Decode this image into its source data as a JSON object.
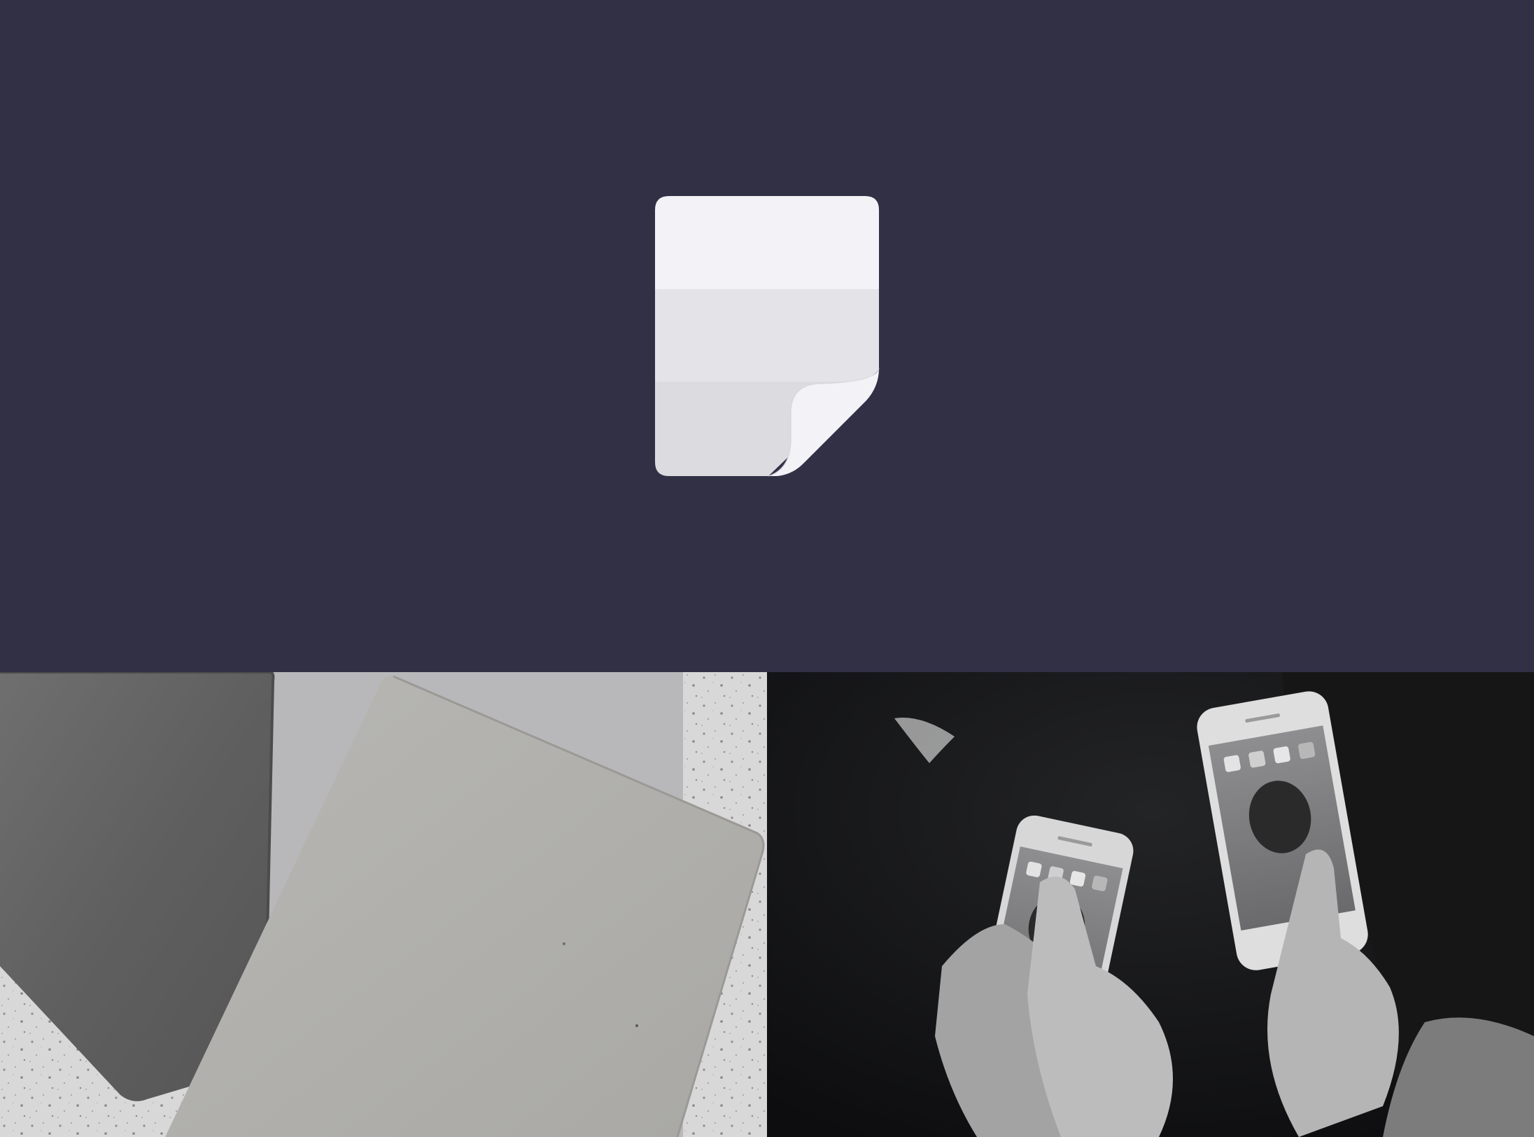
{
  "colors": {
    "hero_background": "#323045",
    "logo_top": "#f3f2f7",
    "logo_middle": "#e4e3e8",
    "logo_bottom": "#dcdbe0",
    "logo_fold": "#f3f2f7"
  },
  "logo": {
    "icon": "sticky-note-icon"
  },
  "photos": [
    {
      "name": "notebooks-photo",
      "style": "grayscale"
    },
    {
      "name": "phones-photo",
      "style": "grayscale"
    }
  ]
}
